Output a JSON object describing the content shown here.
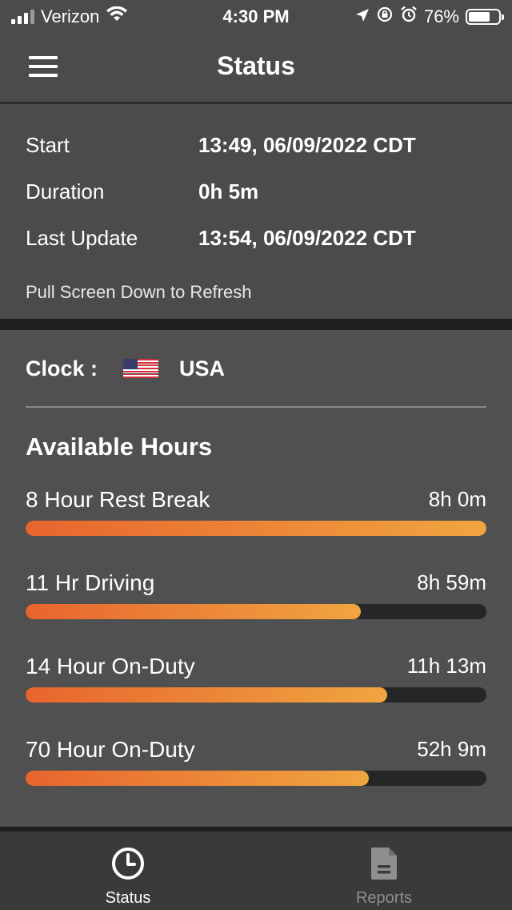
{
  "status_bar": {
    "carrier": "Verizon",
    "time": "4:30 PM",
    "battery_percent": "76%",
    "battery_level": 0.76
  },
  "navbar": {
    "title": "Status"
  },
  "info": {
    "rows": [
      {
        "label": "Start",
        "value": "13:49, 06/09/2022 CDT"
      },
      {
        "label": "Duration",
        "value": "0h 5m"
      },
      {
        "label": "Last Update",
        "value": "13:54, 06/09/2022 CDT"
      }
    ],
    "hint": "Pull Screen Down to Refresh"
  },
  "clock": {
    "label": "Clock :",
    "country": "USA",
    "flag_icon": "us-flag-icon"
  },
  "available_hours": {
    "title": "Available Hours",
    "items": [
      {
        "label": "8 Hour Rest Break",
        "value": "8h 0m",
        "fraction": 1.0
      },
      {
        "label": "11 Hr Driving",
        "value": "8h 59m",
        "fraction": 0.727
      },
      {
        "label": "14 Hour On-Duty",
        "value": "11h 13m",
        "fraction": 0.785
      },
      {
        "label": "70 Hour On-Duty",
        "value": "52h 9m",
        "fraction": 0.744
      }
    ],
    "bar_colors": [
      "#e8652e",
      "#f0a540"
    ]
  },
  "tabbar": {
    "tabs": [
      {
        "label": "Status",
        "icon": "clock-icon",
        "active": true
      },
      {
        "label": "Reports",
        "icon": "document-icon",
        "active": false
      }
    ],
    "active_color": "#ffffff",
    "inactive_color": "#8e8e8e"
  }
}
